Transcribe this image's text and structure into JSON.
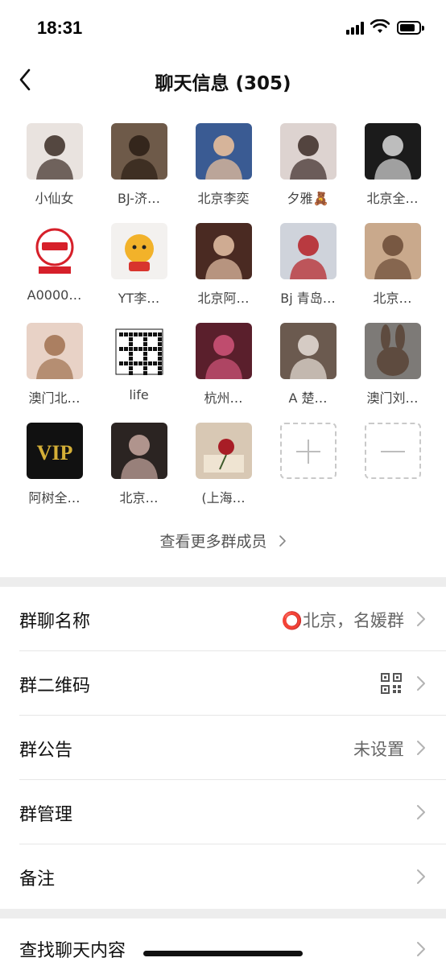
{
  "status_bar": {
    "time": "18:31"
  },
  "header": {
    "title": "聊天信息 (305)"
  },
  "members": [
    {
      "name": "小仙女",
      "avatar": "avatar-photo",
      "bg": "#e9e3df",
      "fg": "#3a2b24"
    },
    {
      "name": "BJ-济…",
      "avatar": "avatar-photo",
      "bg": "#6e5a49",
      "fg": "#2a1d14"
    },
    {
      "name": "北京李奕",
      "avatar": "avatar-photo",
      "bg": "#3a5b93",
      "fg": "#f2c49b"
    },
    {
      "name": "夕雅🧸",
      "avatar": "avatar-photo",
      "bg": "#ddd3d0",
      "fg": "#3b2a26"
    },
    {
      "name": "北京全…",
      "avatar": "avatar-photo",
      "bg": "#1b1b1b",
      "fg": "#d9d9d9"
    },
    {
      "name": "A0000…",
      "avatar": "avatar-logo",
      "bg": "#ffffff",
      "fg": "#d6202a"
    },
    {
      "name": "YT李…",
      "avatar": "avatar-cartoon",
      "bg": "#f3f1ef",
      "fg": "#f2b22a"
    },
    {
      "name": "北京阿…",
      "avatar": "avatar-photo",
      "bg": "#4a2a22",
      "fg": "#e6c2a6"
    },
    {
      "name": "Bj 青岛…",
      "avatar": "avatar-photo",
      "bg": "#cfd3db",
      "fg": "#b51f24"
    },
    {
      "name": "北京…",
      "avatar": "avatar-photo",
      "bg": "#c9a98c",
      "fg": "#6a4a35"
    },
    {
      "name": "澳门北…",
      "avatar": "avatar-photo",
      "bg": "#e8d2c6",
      "fg": "#a0714f"
    },
    {
      "name": "life",
      "avatar": "avatar-qr",
      "bg": "#ffffff",
      "fg": "#111111"
    },
    {
      "name": "杭州…",
      "avatar": "avatar-photo",
      "bg": "#5a1f2c",
      "fg": "#d1557a"
    },
    {
      "name": "A  楚…",
      "avatar": "avatar-photo",
      "bg": "#6b5a4f",
      "fg": "#e8dfd8"
    },
    {
      "name": "澳门刘…",
      "avatar": "avatar-rabbit",
      "bg": "#7d7a77",
      "fg": "#5e4b3f"
    },
    {
      "name": "阿树全…",
      "avatar": "avatar-vip",
      "bg": "#111111",
      "fg": "#d4af37"
    },
    {
      "name": "北京…",
      "avatar": "avatar-photo",
      "bg": "#2b2422",
      "fg": "#c8a8a0"
    },
    {
      "name": "(上海…",
      "avatar": "avatar-rose",
      "bg": "#d8c8b4",
      "fg": "#a81d26"
    }
  ],
  "grid_actions": {
    "add": "+",
    "remove": "−"
  },
  "more_members": {
    "label": "查看更多群成员"
  },
  "settings": [
    {
      "label": "群聊名称",
      "value": "⭕北京，名媛群"
    },
    {
      "label": "群二维码",
      "value": ""
    },
    {
      "label": "群公告",
      "value": "未设置"
    },
    {
      "label": "群管理",
      "value": ""
    },
    {
      "label": "备注",
      "value": ""
    }
  ],
  "search_row": {
    "label": "查找聊天内容"
  },
  "colors": {
    "background": "#ffffff",
    "section_gap": "#ededed",
    "divider": "#e6e6e6",
    "chevron": "#b3b3b3",
    "text_secondary": "#666666"
  }
}
